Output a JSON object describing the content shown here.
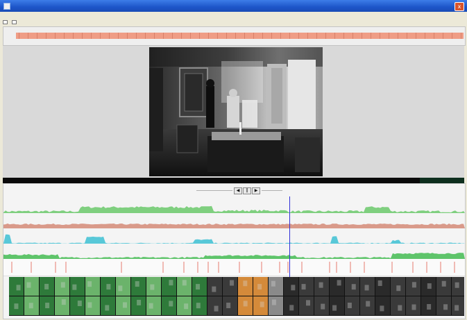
{
  "window": {
    "title": "",
    "close_glyph": "x",
    "accent": "#1d55c9"
  },
  "menu": {
    "items": [
      "",
      ""
    ]
  },
  "ruler": {
    "color": "#ef9d86",
    "left_label": "",
    "center_top_label": "",
    "center_bottom_label": "",
    "right_label": ""
  },
  "player": {
    "buttons": [
      "◀",
      "‖",
      "▶"
    ]
  },
  "tracks": [
    {
      "name": "green-track",
      "color": "#7fcf7f"
    },
    {
      "name": "salmon-track",
      "color": "#d99a8a"
    },
    {
      "name": "cyan-track",
      "color": "#58c8d8"
    },
    {
      "name": "green-track-2",
      "color": "#5ec46a"
    }
  ],
  "markers": {
    "color": "#e05a4a"
  },
  "playhead": {
    "color": "#2f2fd8"
  },
  "filmstrip": {
    "colors": [
      "#2e7a3a",
      "#6bb36b",
      "#2a2a2a",
      "#d48a3a",
      "#8a8a8a",
      "#3a3a3a"
    ]
  }
}
